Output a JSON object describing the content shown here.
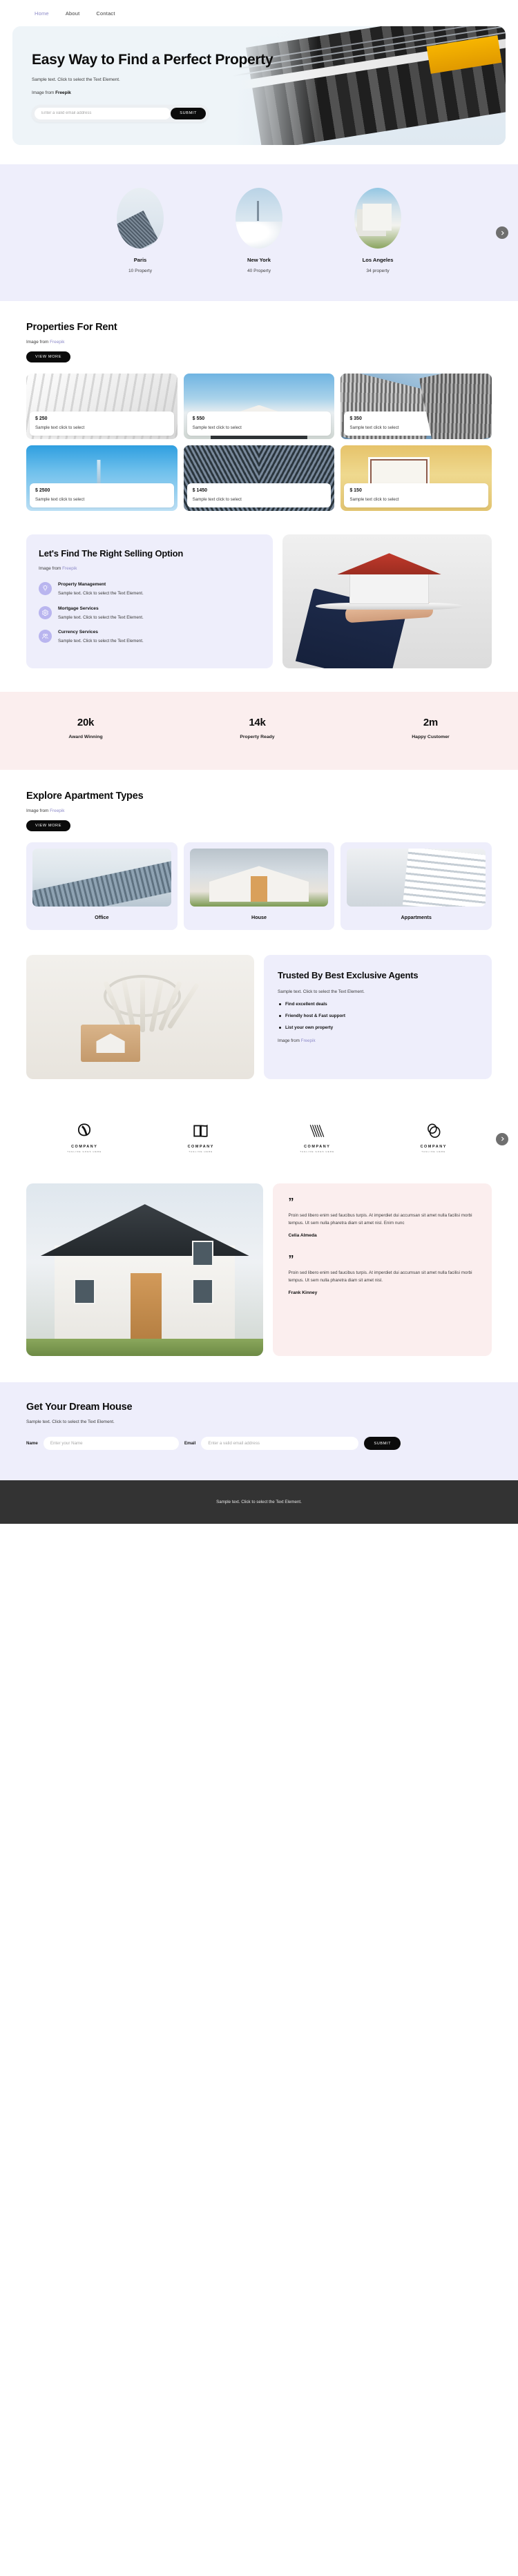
{
  "nav": {
    "items": [
      {
        "label": "Home",
        "active": true
      },
      {
        "label": "About",
        "active": false
      },
      {
        "label": "Contact",
        "active": false
      }
    ]
  },
  "hero": {
    "title": "Easy Way to Find a Perfect Property",
    "subtitle": "Sample text. Click to select the Text Element.",
    "credit_prefix": "Image from ",
    "credit_link": "Freepik",
    "email_placeholder": "Enter a valid email address",
    "email_value": "",
    "submit_label": "SUBMIT"
  },
  "cities": {
    "items": [
      {
        "name": "Paris",
        "count": "10 Property",
        "image": "paris-building-photo"
      },
      {
        "name": "New York",
        "count": "40 Property",
        "image": "new-york-skyline-photo"
      },
      {
        "name": "Los Angeles",
        "count": "34 property",
        "image": "los-angeles-villa-photo"
      }
    ],
    "next_icon": "chevron-right-icon"
  },
  "properties_section": {
    "title": "Properties For Rent",
    "credit_prefix": "Image from ",
    "credit_link": "Freepik",
    "view_more_label": "VIEW MORE",
    "cards": [
      {
        "price": "$ 250",
        "desc": "Sample text click to select"
      },
      {
        "price": "$ 550",
        "desc": "Sample text click to select"
      },
      {
        "price": "$ 350",
        "desc": "Sample text click to select"
      },
      {
        "price": "$ 2500",
        "desc": "Sample text click to select"
      },
      {
        "price": "$ 1450",
        "desc": "Sample text click to select"
      },
      {
        "price": "$ 150",
        "desc": "Sample text click to select"
      }
    ]
  },
  "selling": {
    "title": "Let's Find The Right Selling Option",
    "credit_prefix": "Image from ",
    "credit_link": "Freepik",
    "features": [
      {
        "name": "Property Management",
        "text": "Sample text. Click to select the Text Element.",
        "icon": "lightbulb-icon"
      },
      {
        "name": "Mortgage Services",
        "text": "Sample text. Click to select the Text Element.",
        "icon": "gear-icon"
      },
      {
        "name": "Currency Services",
        "text": "Sample text. Click to select the Text Element.",
        "icon": "users-icon"
      }
    ],
    "image": "hand-holding-model-house-photo"
  },
  "stats": {
    "items": [
      {
        "number": "20k",
        "label": "Award Winning"
      },
      {
        "number": "14k",
        "label": "Property Ready"
      },
      {
        "number": "2m",
        "label": "Happy Customer"
      }
    ]
  },
  "apartments_section": {
    "title": "Explore Apartment Types",
    "credit_prefix": "Image from ",
    "credit_link": "Freepik",
    "view_more_label": "VIEW MORE",
    "cards": [
      {
        "name": "Office",
        "image": "glass-office-building-photo"
      },
      {
        "name": "House",
        "image": "modern-house-photo"
      },
      {
        "name": "Appartments",
        "image": "white-apartment-block-photo"
      }
    ]
  },
  "trusted": {
    "title": "Trusted By Best Exclusive Agents",
    "subtitle": "Sample text. Click to select the Text Element.",
    "bullets": [
      "Find excellent deals",
      "Friendly host & Fast support",
      "List your own property"
    ],
    "credit_prefix": "Image from ",
    "credit_link": "Freepik",
    "image": "house-keys-photo"
  },
  "logos": {
    "items": [
      {
        "name": "COMPANY",
        "tagline": "TAGLINE GOES HERE",
        "icon": "infinity-loop-logo-icon"
      },
      {
        "name": "COMPANY",
        "tagline": "TAGLINE HERE",
        "icon": "open-book-logo-icon"
      },
      {
        "name": "COMPANY",
        "tagline": "TAGLINE GOES HERE",
        "icon": "v-stripes-logo-icon"
      },
      {
        "name": "COMPANY",
        "tagline": "TAGLINE HERE",
        "icon": "double-circle-logo-icon"
      }
    ],
    "next_icon": "chevron-right-icon"
  },
  "testimonials": {
    "image": "white-house-exterior-photo",
    "quote_mark": "”",
    "items": [
      {
        "text": "Proin sed libero enim sed faucibus turpis. At imperdiet dui accumsan sit amet nulla facilisi morbi tempus. Ut sem nulla pharetra diam sit amet nisl. Enim nunc",
        "name": "Celia Almeda"
      },
      {
        "text": "Proin sed libero enim sed faucibus turpis. At imperdiet dui accumsan sit amet nulla facilisi morbi tempus. Ut sem nulla pharetra diam sit amet nisl.",
        "name": "Frank Kinney"
      }
    ]
  },
  "cta": {
    "title": "Get Your Dream House",
    "subtitle": "Sample text. Click to select the Text Element.",
    "name_label": "Name",
    "name_placeholder": "Enter your Name",
    "name_value": "",
    "email_label": "Email",
    "email_placeholder": "Enter a valid email address",
    "email_value": "",
    "submit_label": "SUBMIT"
  },
  "footer": {
    "text": "Sample text. Click to select the Text Element."
  },
  "colors": {
    "lavender_bg": "#eeeefb",
    "pink_bg": "#fbeeee",
    "accent_link": "#8e8bc9",
    "dark_button": "#0b0b0b",
    "footer_bg": "#333333",
    "icon_circle": "#b9b5ef"
  }
}
